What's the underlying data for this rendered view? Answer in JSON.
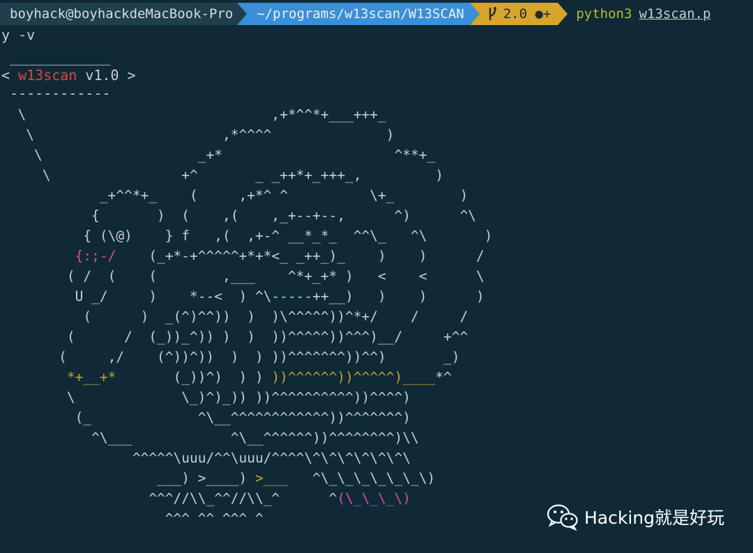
{
  "window": {
    "prompt": {
      "user_host": "boyhack@boyhackdeMacBook-Pro",
      "path": "~/programs/w13scan/W13SCAN",
      "git_branch_icon": "git-branch-icon",
      "git_status": "2.0 ●+",
      "command": "python3",
      "command_arg": "w13scan.p",
      "command_wrap": "y -v"
    },
    "banner": {
      "rule_top": " ____________",
      "open": "< ",
      "name": "w13scan",
      "version": " v1.0 >",
      "rule_bottom": " ------------"
    },
    "ascii_art": [
      "  \\                              ,+*^^*+___+++_",
      "   \\                       ,*^^^^              )",
      "    \\                   _+*                     ^**+_",
      "     \\                +^       _ _++*+_+++_,         )",
      "            _+^^*+_    (     ,+*^ ^          \\+_        )",
      "           {       )  (    ,(    ,_+--+--,      ^)      ^\\",
      "          { (\\@)    } f   ,(  ,+-^ __*_*_  ^^\\_   ^\\       )",
      "         {:;-/    (_+*-+^^^^^+*+*<_ _++_)_    )    )      /",
      "        ( /  (    (        ,___    ^*+_+* )   <    <      \\",
      "         U _/     )    *--<  ) ^\\-----++__)   )    )      )",
      "          (      )  _(^)^^))  )  )\\^^^^^))^*+/    /     /",
      "        (      /  (_))_^)) )  )  ))^^^^^))^^^)__/     +^^",
      "       (     ,/    (^))^))  )  ) ))^^^^^^^))^^)       _)",
      "        *+__+*       (_))^)  ) ) ))^^^^^^))^^^^^)____*^",
      "        \\             \\_)^)_)) ))^^^^^^^^^^))^^^^)",
      "         (_             ^\\__^^^^^^^^^^^^))^^^^^^^)",
      "           ^\\___            ^\\__^^^^^^))^^^^^^^^)\\\\",
      "                ^^^^^\\uuu/^^\\uuu/^^^^\\^\\^\\^\\^\\^\\^\\",
      "                   ___) >____) >___   ^\\_\\_\\_\\_\\_\\_\\)",
      "                  ^^^//\\\\_^^//\\\\_^      ^(\\_\\_\\_\\)",
      "                    ^^^ ^^ ^^^ ^"
    ],
    "watermark": {
      "icon": "wechat-icon",
      "text": "Hacking就是好玩"
    }
  }
}
